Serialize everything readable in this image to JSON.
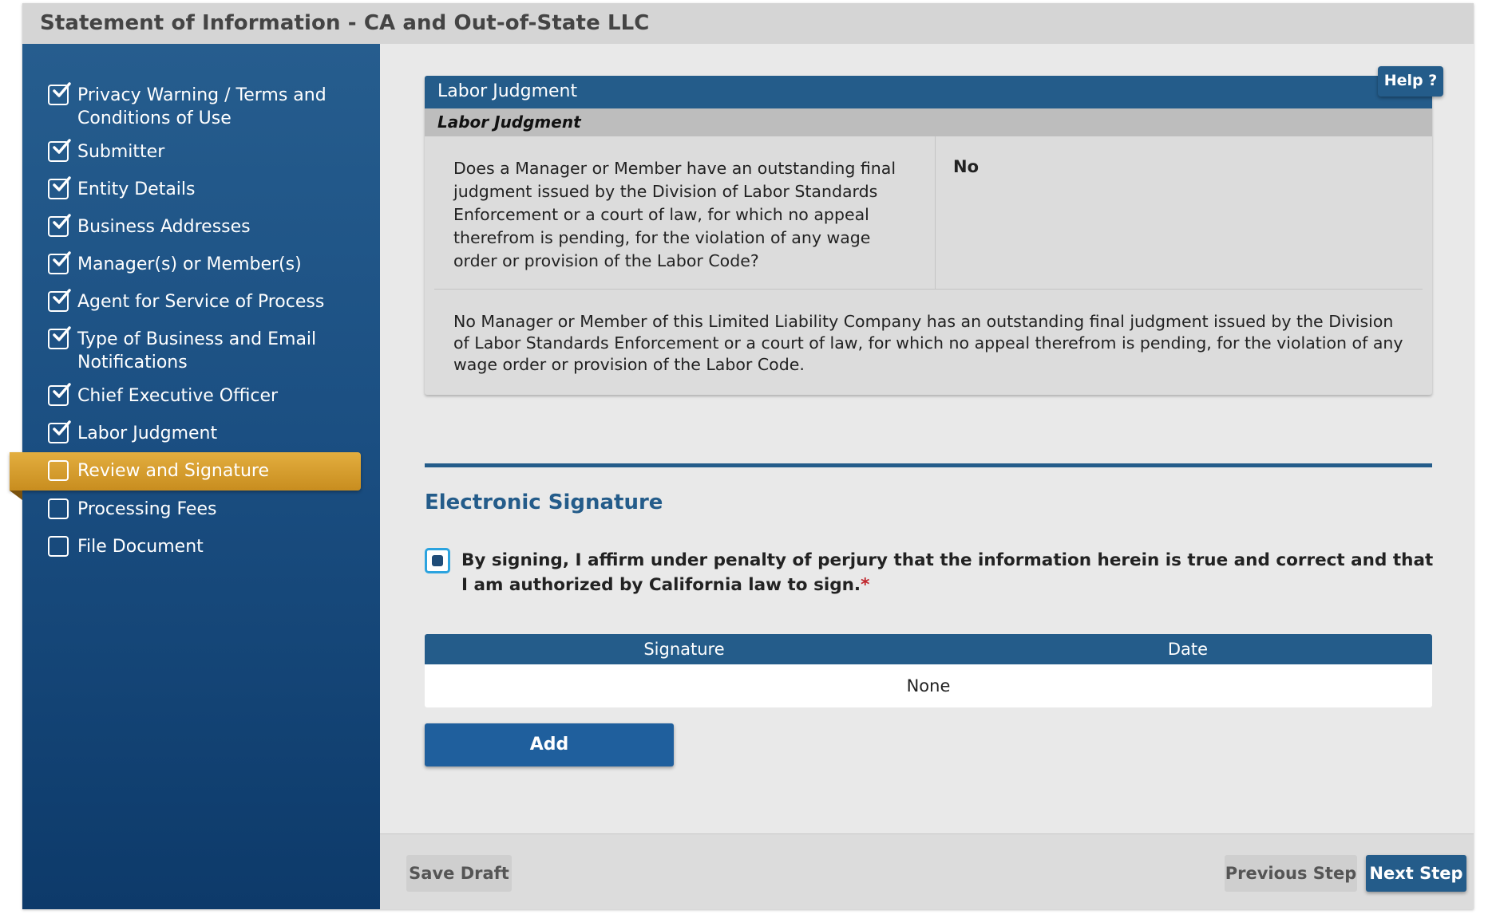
{
  "window": {
    "title": "Statement of Information - CA and Out-of-State LLC"
  },
  "sidebar": {
    "items": [
      {
        "label": "Privacy Warning / Terms and Conditions of Use",
        "state": "done"
      },
      {
        "label": "Submitter",
        "state": "done"
      },
      {
        "label": "Entity Details",
        "state": "done"
      },
      {
        "label": "Business Addresses",
        "state": "done"
      },
      {
        "label": "Manager(s) or Member(s)",
        "state": "done"
      },
      {
        "label": "Agent for Service of Process",
        "state": "done"
      },
      {
        "label": "Type of Business and Email Notifications",
        "state": "done"
      },
      {
        "label": "Chief Executive Officer",
        "state": "done"
      },
      {
        "label": "Labor Judgment",
        "state": "done"
      },
      {
        "label": "Review and Signature",
        "state": "active"
      },
      {
        "label": "Processing Fees",
        "state": "pending"
      },
      {
        "label": "File Document",
        "state": "pending"
      }
    ]
  },
  "labor_panel": {
    "header": "Labor Judgment",
    "subheader": "Labor Judgment",
    "help_label": "Help ?",
    "question": "Does a Manager or Member have an outstanding final judgment issued by the Division of Labor Standards Enforcement or a court of law, for which no appeal therefrom is pending, for the violation of any wage order or provision of the Labor Code?",
    "answer": "No",
    "statement": "No Manager or Member of this Limited Liability Company has an outstanding final judgment issued by the Division of Labor Standards Enforcement or a court of law, for which no appeal therefrom is pending, for the violation of any wage order or provision of the Labor Code."
  },
  "signature": {
    "title": "Electronic Signature",
    "affirm_text": "By signing, I affirm under penalty of perjury that the information herein is true and correct and that I am authorized by California law to sign.",
    "required_mark": "*",
    "affirm_checked": true,
    "table": {
      "columns": [
        "Signature",
        "Date"
      ],
      "empty_text": "None"
    },
    "add_label": "Add"
  },
  "footer": {
    "save_label": "Save Draft",
    "prev_label": "Previous Step",
    "next_label": "Next Step"
  },
  "colors": {
    "primary": "#245c8a",
    "active_nav": "#d9a033",
    "checkbox_focus": "#2ba3df",
    "required": "#c0252c"
  }
}
